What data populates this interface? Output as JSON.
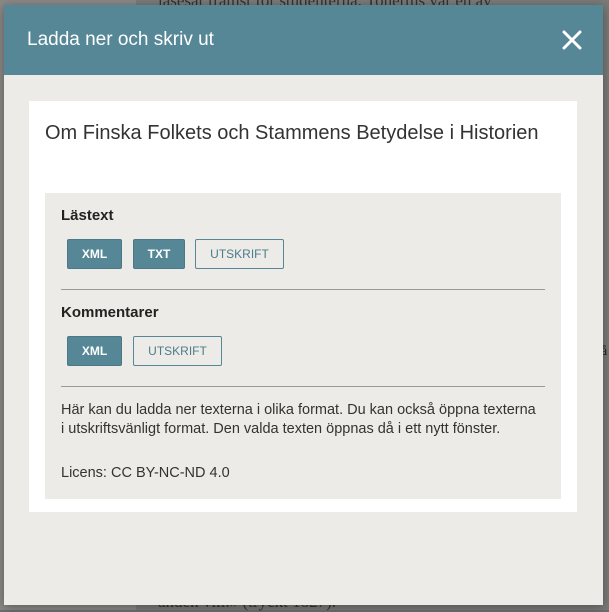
{
  "background": {
    "top_text": "läsesät framst för studenterna. Tonertus var en av",
    "bottom_text": "andén vill.» (tryckt 1827).",
    "right_mark": "å"
  },
  "dialog": {
    "title": "Ladda ner och skriv ut",
    "close_icon": "close-icon",
    "document_title": "Om Finska Folkets och Stammens Betydelse i Historien",
    "sections": {
      "lastext": {
        "label": "Lästext",
        "buttons": [
          "XML",
          "TXT",
          "UTSKRIFT"
        ]
      },
      "kommentarer": {
        "label": "Kommentarer",
        "buttons": [
          "XML",
          "UTSKRIFT"
        ]
      }
    },
    "description": "Här kan du ladda ner texterna i olika format. Du kan också öppna texterna i utskriftsvänligt format. Den valda texten öppnas då i ett nytt fönster.",
    "license": "Licens: CC BY-NC-ND 4.0"
  },
  "colors": {
    "header": "#568796",
    "panel": "#edebe7",
    "button_fill": "#568796"
  }
}
